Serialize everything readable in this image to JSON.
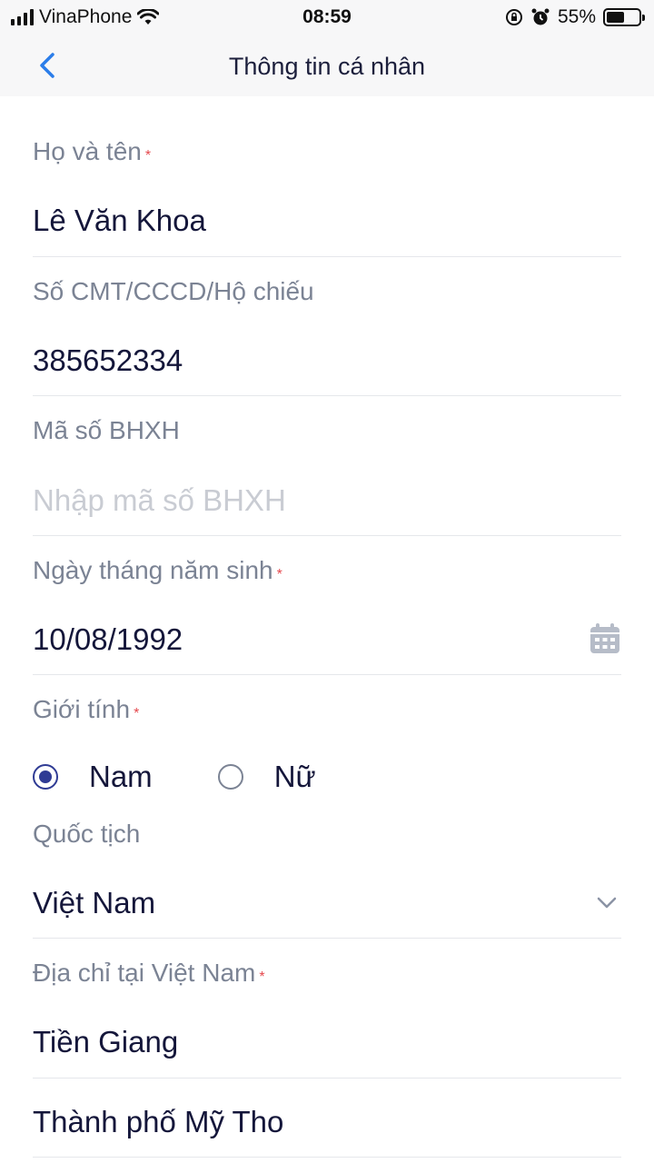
{
  "status_bar": {
    "carrier": "VinaPhone",
    "time": "08:59",
    "battery_percent": "55%",
    "battery_level": 0.55
  },
  "header": {
    "title": "Thông tin cá nhân",
    "back_icon": "chevron-left-icon"
  },
  "form": {
    "full_name": {
      "label": "Họ và tên",
      "required": "*",
      "value": "Lê Văn Khoa"
    },
    "id_number": {
      "label": "Số CMT/CCCD/Hộ chiếu",
      "value": "385652334"
    },
    "social_insurance": {
      "label": "Mã số BHXH",
      "placeholder": "Nhập mã số BHXH"
    },
    "dob": {
      "label": "Ngày tháng năm sinh",
      "required": "*",
      "value": "10/08/1992",
      "icon": "calendar-icon"
    },
    "gender": {
      "label": "Giới tính",
      "required": "*",
      "options": [
        {
          "label": "Nam",
          "selected": true
        },
        {
          "label": "Nữ",
          "selected": false
        }
      ]
    },
    "nationality": {
      "label": "Quốc tịch",
      "value": "Việt Nam",
      "icon": "chevron-down-icon"
    },
    "address": {
      "label": "Địa chỉ tại Việt Nam",
      "required": "*",
      "province": "Tiền Giang",
      "district": "Thành phố Mỹ Tho"
    }
  },
  "colors": {
    "accent": "#2f3b94",
    "back_icon": "#2b7de9",
    "required": "#e5484d",
    "label": "#7b8394"
  }
}
